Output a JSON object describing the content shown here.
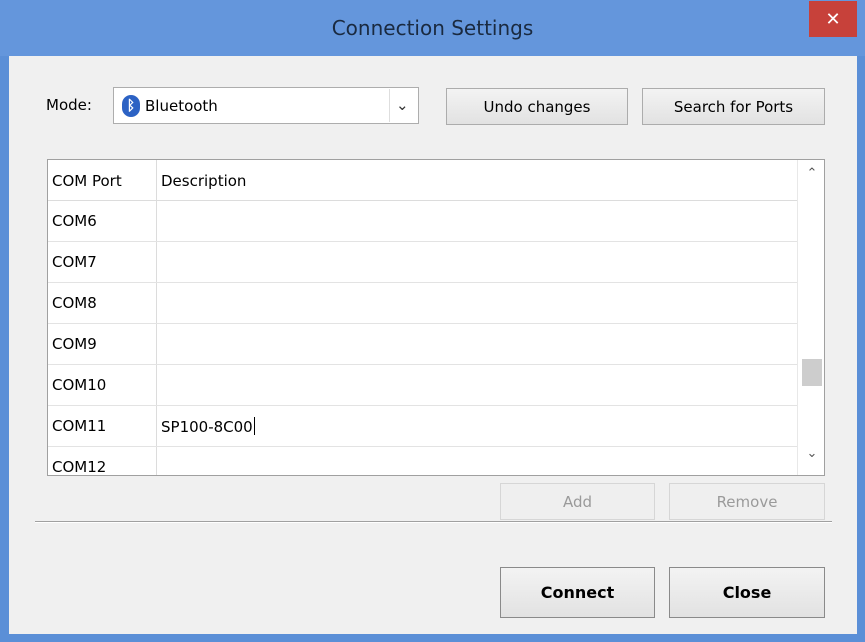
{
  "window": {
    "title": "Connection Settings",
    "close_glyph": "✕"
  },
  "mode": {
    "label": "Mode:",
    "selected": "Bluetooth",
    "icon": "bluetooth-icon",
    "dropdown_glyph": "⌄"
  },
  "buttons": {
    "undo": "Undo changes",
    "search": "Search for Ports",
    "add": "Add",
    "remove": "Remove",
    "connect": "Connect",
    "close": "Close"
  },
  "table": {
    "columns": [
      "COM Port",
      "Description"
    ],
    "rows": [
      {
        "port": "COM6",
        "description": ""
      },
      {
        "port": "COM7",
        "description": ""
      },
      {
        "port": "COM8",
        "description": ""
      },
      {
        "port": "COM9",
        "description": ""
      },
      {
        "port": "COM10",
        "description": ""
      },
      {
        "port": "COM11",
        "description": "SP100-8C00"
      },
      {
        "port": "COM12",
        "description": ""
      }
    ],
    "scroll_up_glyph": "⌃",
    "scroll_down_glyph": "⌄"
  },
  "colors": {
    "title_bar": "#6496dc",
    "close_button": "#c7413a",
    "bluetooth": "#2c62c4"
  }
}
